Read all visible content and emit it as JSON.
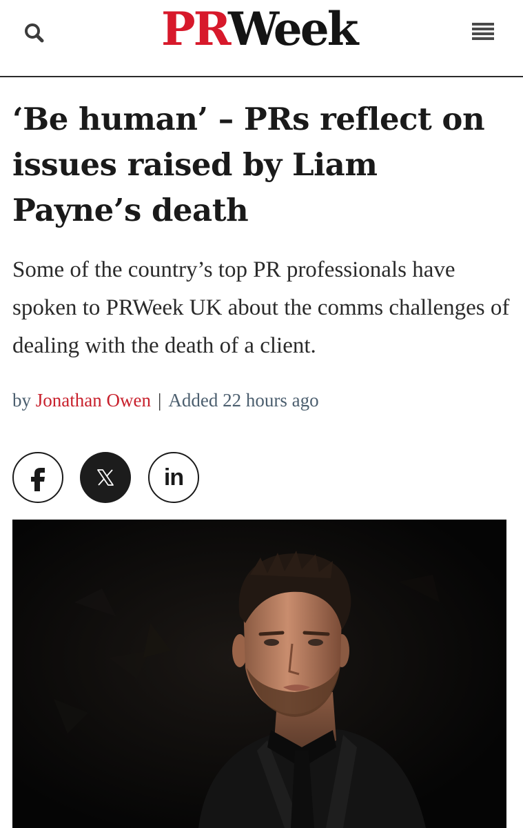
{
  "header": {
    "logo_pr": "PR",
    "logo_week": "Week",
    "search_icon": "search-icon",
    "menu_icon": "hamburger-menu-icon"
  },
  "article": {
    "headline": "‘Be human’ – PRs reflect on issues raised by Liam Payne’s death",
    "standfirst": "Some of the country’s top PR professionals have spoken to PRWeek UK about the comms challenges of dealing with the death of a client.",
    "byline_prefix": "by",
    "author": "Jonathan Owen",
    "separator": "|",
    "added": "Added 22 hours ago"
  },
  "share": {
    "facebook_label": "f",
    "x_label": "𝕏",
    "linkedin_label": "in"
  },
  "colors": {
    "brand_red": "#d7192b",
    "author_red": "#c8202c",
    "meta_slate": "#4b5e6e",
    "text_dark": "#1a1a1a"
  }
}
